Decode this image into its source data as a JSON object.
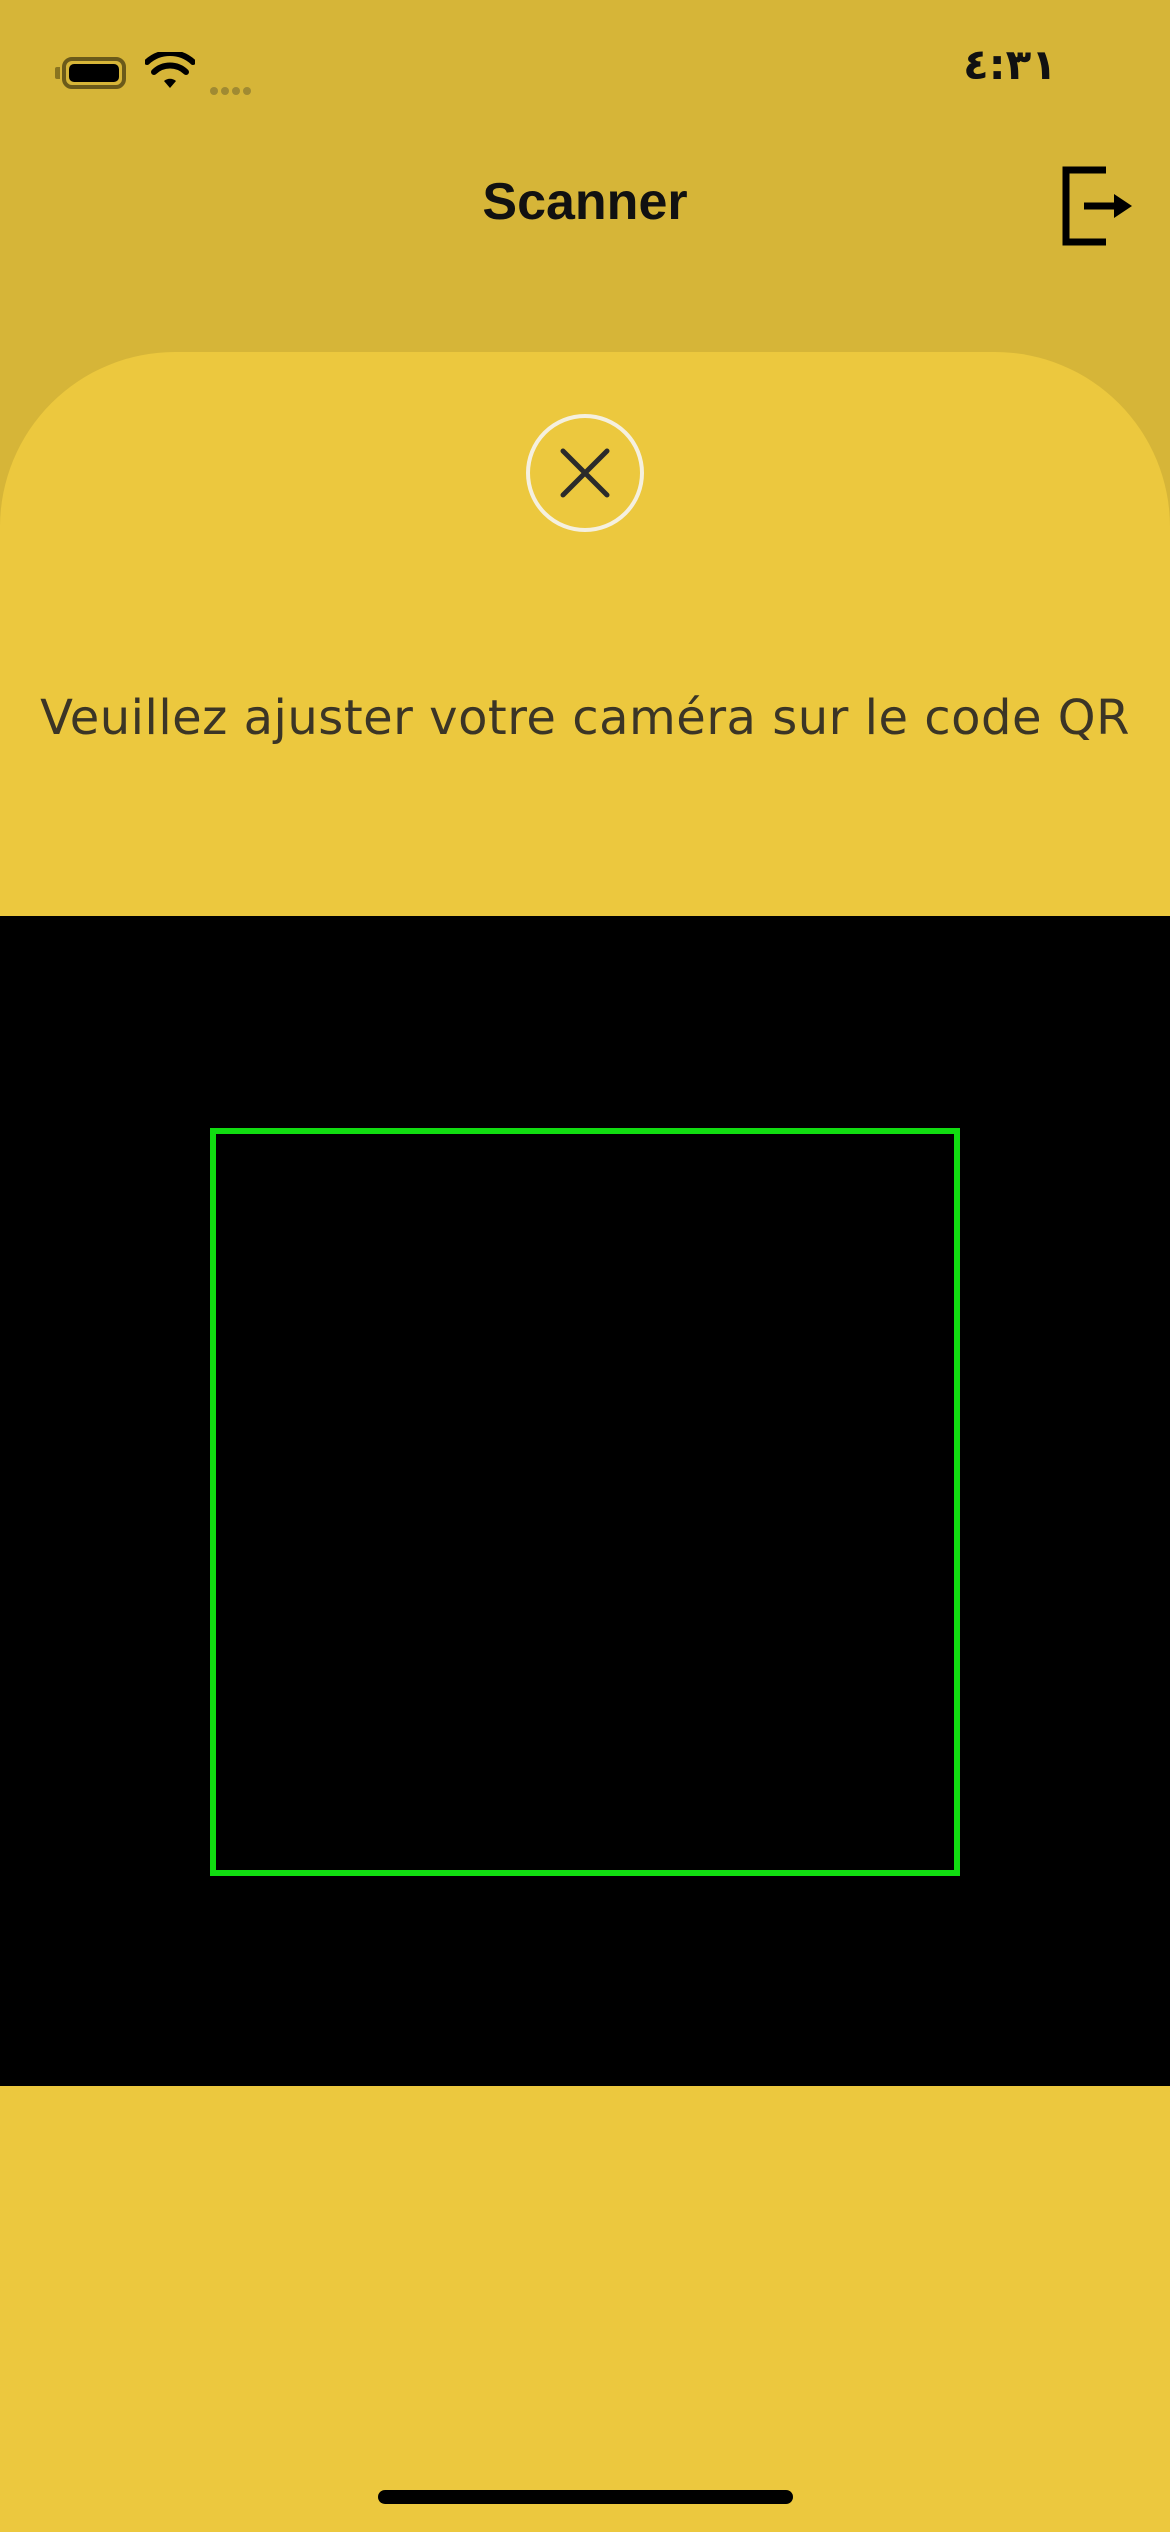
{
  "status_bar": {
    "time": "٤:٣١"
  },
  "header": {
    "title": "Scanner"
  },
  "scanner": {
    "instruction": "Veuillez ajuster votre caméra sur le code QR",
    "frame_color": "#11dd11"
  },
  "colors": {
    "background": "#ecc83e",
    "header": "#d6b538",
    "camera": "#000000"
  },
  "icons": {
    "logout": "logout-icon",
    "close": "close-icon",
    "wifi": "wifi-icon",
    "battery": "battery-icon"
  }
}
